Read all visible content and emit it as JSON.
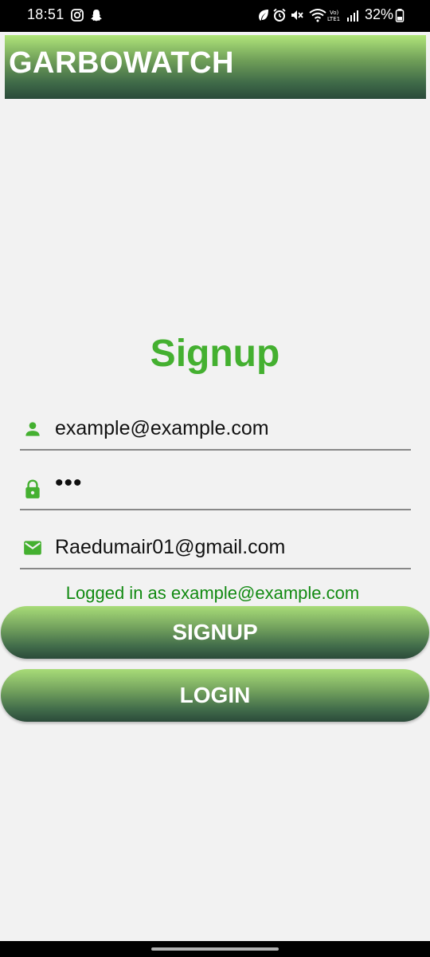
{
  "status_bar": {
    "time": "18:51",
    "battery": "32%",
    "icons": [
      "instagram-icon",
      "snapchat-icon",
      "leaf-icon",
      "alarm-icon",
      "mute-icon",
      "wifi-icon",
      "volte-icon",
      "signal-icon",
      "battery-icon"
    ]
  },
  "header": {
    "title": "GARBOWATCH"
  },
  "form": {
    "heading": "Signup",
    "username": {
      "value": "example@example.com",
      "icon": "person-icon"
    },
    "password": {
      "value": "•••",
      "icon": "lock-icon"
    },
    "email": {
      "value": "Raedumair01@gmail.com",
      "icon": "mail-icon"
    },
    "status_text": "Logged in as example@example.com",
    "signup_label": "SIGNUP",
    "login_label": "LOGIN"
  },
  "colors": {
    "accent_green": "#44b030",
    "status_green": "#128a12",
    "gradient_top": "#b0e57a",
    "gradient_bottom": "#2b4a3a"
  }
}
